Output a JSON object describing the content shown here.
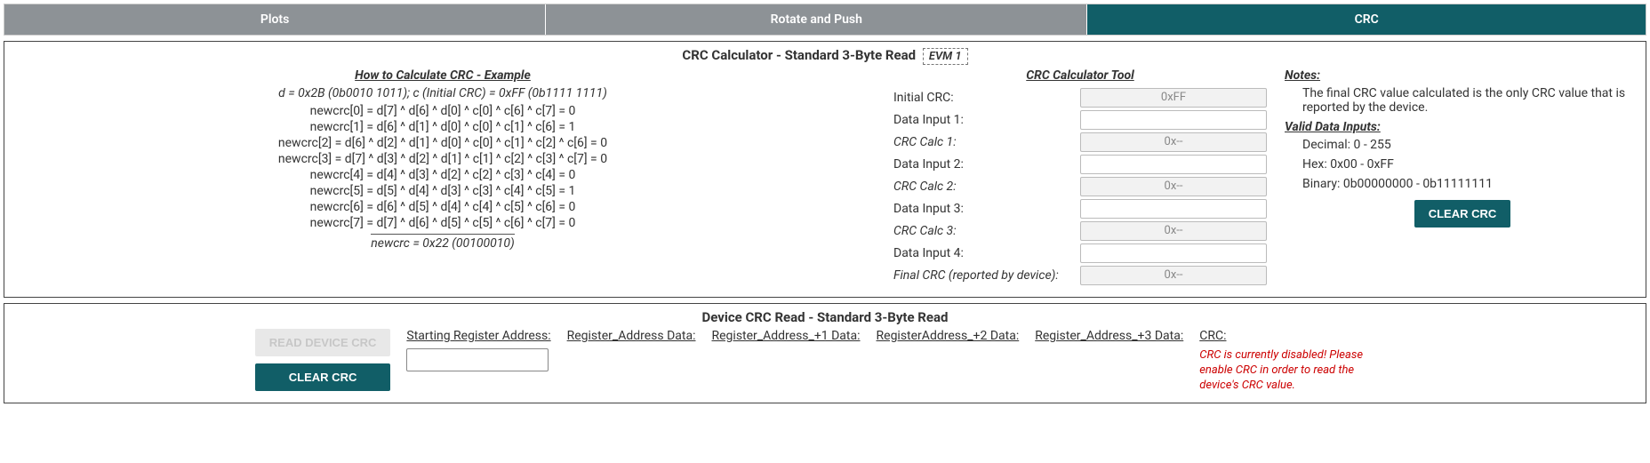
{
  "tabs": {
    "plots": "Plots",
    "rotate": "Rotate and Push",
    "crc": "CRC"
  },
  "calc": {
    "title": "CRC Calculator - Standard 3-Byte Read",
    "badge": "EVM 1",
    "example": {
      "heading": "How to Calculate CRC - Example",
      "top": "d = 0x2B (0b0010 1011); c (Initial CRC) = 0xFF (0b1111 1111)",
      "lines": [
        "newcrc[0] = d[7] ^ d[6] ^ d[0] ^ c[0] ^ c[6] ^ c[7] = 0",
        "newcrc[1] = d[6] ^ d[1] ^ d[0] ^ c[0] ^ c[1] ^ c[6] = 1",
        "newcrc[2] = d[6] ^ d[2] ^ d[1] ^ d[0] ^ c[0] ^ c[1] ^ c[2] ^ c[6] = 0",
        "newcrc[3] = d[7] ^ d[3] ^ d[2] ^ d[1] ^ c[1] ^ c[2] ^ c[3] ^ c[7] = 0",
        "newcrc[4] = d[4] ^ d[3] ^ d[2] ^ c[2] ^ c[3] ^ c[4] = 0",
        "newcrc[5] = d[5] ^ d[4] ^ d[3] ^ c[3] ^ c[4] ^ c[5] = 1",
        "newcrc[6] = d[6] ^ d[5] ^ d[4] ^ c[4] ^ c[5] ^ c[6] = 0",
        "newcrc[7] = d[7] ^ d[6] ^ d[5] ^ c[5] ^ c[6] ^ c[7] = 0"
      ],
      "result": "newcrc = 0x22 (00100010)"
    },
    "tool": {
      "heading": "CRC Calculator Tool",
      "rows": {
        "initial_crc_label": "Initial CRC:",
        "initial_crc_value": "0xFF",
        "data1_label": "Data Input 1:",
        "data1_value": "",
        "calc1_label": "CRC Calc 1:",
        "calc1_value": "0x--",
        "data2_label": "Data Input 2:",
        "data2_value": "",
        "calc2_label": "CRC Calc 2:",
        "calc2_value": "0x--",
        "data3_label": "Data Input 3:",
        "data3_value": "",
        "calc3_label": "CRC Calc 3:",
        "calc3_value": "0x--",
        "data4_label": "Data Input 4:",
        "data4_value": "",
        "final_label": "Final CRC (reported by device):",
        "final_value": "0x--"
      }
    },
    "notes": {
      "heading": "Notes:",
      "note_text": "The final CRC value calculated is the only CRC value that is reported by the device.",
      "valid_heading": "Valid Data Inputs:",
      "valid1": "Decimal: 0 - 255",
      "valid2": "Hex: 0x00 - 0xFF",
      "valid3": "Binary: 0b00000000 - 0b11111111",
      "clear_btn": "CLEAR CRC"
    }
  },
  "device": {
    "title": "Device CRC Read - Standard 3-Byte Read",
    "read_btn": "READ DEVICE CRC",
    "clear_btn": "CLEAR CRC",
    "cols": {
      "start_addr": "Starting Register Address:",
      "reg_addr_data": "Register_Address Data:",
      "reg_addr_p1": "Register_Address_+1 Data:",
      "reg_addr_p2": "RegisterAddress_+2 Data:",
      "reg_addr_p3": "Register_Address_+3 Data:",
      "crc": "CRC:"
    },
    "crc_warning": "CRC is currently disabled! Please enable CRC in order to read the device's CRC value."
  }
}
